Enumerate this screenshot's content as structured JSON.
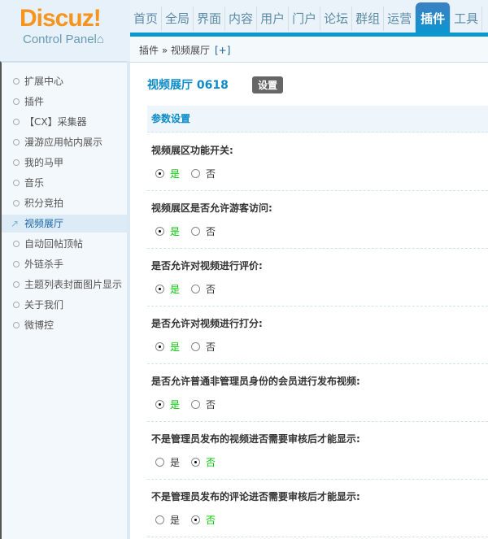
{
  "logo": {
    "brand": "Discuz!",
    "sub": "Control Panel"
  },
  "nav": [
    "首页",
    "全局",
    "界面",
    "内容",
    "用户",
    "门户",
    "论坛",
    "群组",
    "运营",
    "插件",
    "工具"
  ],
  "nav_active": 9,
  "breadcrumb": {
    "path": "插件 » 视频展厅",
    "plus": "[+]"
  },
  "sidebar": {
    "items": [
      "扩展中心",
      "插件",
      "【CX】采集器",
      "漫游应用帖内展示",
      "我的马甲",
      "音乐",
      "积分竞拍",
      "视频展厅",
      "自动回帖顶帖",
      "外链杀手",
      "主题列表封面图片显示",
      "关于我们",
      "微博控"
    ],
    "active": 7
  },
  "main": {
    "title": "视频展厅 0618",
    "settings_button": "设置",
    "section": "参数设置",
    "yes": "是",
    "no": "否",
    "rows": [
      {
        "label": "视频展区功能开关:",
        "value": "yes"
      },
      {
        "label": "视频展区是否允许游客访问:",
        "value": "yes"
      },
      {
        "label": "是否允许对视频进行评价:",
        "value": "yes"
      },
      {
        "label": "是否允许对视频进行打分:",
        "value": "yes"
      },
      {
        "label": "是否允许普通非管理员身份的会员进行发布视频:",
        "value": "yes"
      },
      {
        "label": "不是管理员发布的视频进否需要审核后才能显示:",
        "value": "no"
      },
      {
        "label": "不是管理员发布的评论进否需要审核后才能显示:",
        "value": "no"
      }
    ]
  },
  "colors": {
    "accent": "#0d8bc7",
    "selected_text": "#00c800",
    "logo": "#f7941d"
  }
}
